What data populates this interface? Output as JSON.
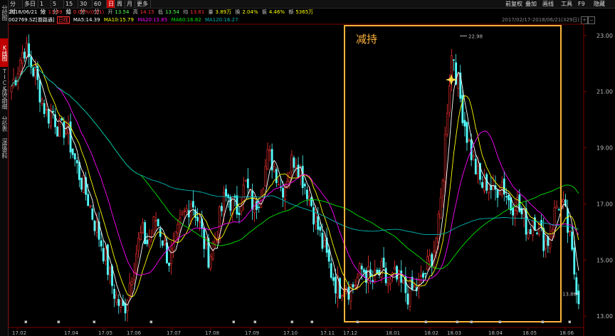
{
  "sidebar": {
    "items": [
      {
        "label": "分时图",
        "active": false
      },
      {
        "label": "K线图",
        "active": true
      },
      {
        "label": "TICK",
        "active": false
      },
      {
        "label": "成交明细",
        "active": false
      },
      {
        "label": "分价表",
        "active": false
      },
      {
        "label": "深度资料",
        "active": false
      }
    ]
  },
  "toolbar": {
    "periods": [
      "分时",
      "多日",
      "1分",
      "5分",
      "15分",
      "30分",
      "60分",
      "日",
      "周",
      "月",
      "更多"
    ],
    "active_period": "日",
    "right_buttons": [
      "前复权",
      "叠加",
      "画线",
      "工具",
      "F9",
      "隐藏"
    ]
  },
  "quote": {
    "date": "2018/06/21",
    "open_label": "收",
    "open_value": "13.69",
    "change_label": "幅",
    "change_value": "0.07%(0.01)",
    "kai_label": "开",
    "kai_value": "13.54",
    "high_label": "高",
    "high_value": "14.15",
    "low_label": "低",
    "low_value": "13.54",
    "avg_label": "均",
    "avg_value": "13.81",
    "vol_label": "量",
    "vol_value": "3.89万",
    "turnover_label": "换",
    "turnover_value": "2.04%",
    "amp_label": "振",
    "amp_value": "4.46%",
    "amount_label": "额",
    "amount_value": "5365万"
  },
  "ma": {
    "code": "002769.SZ",
    "name": "[普路通]",
    "mode": "日线",
    "ma5": "MA5:14.39",
    "ma10": "MA10:15.79",
    "ma20": "MA20:15.85",
    "ma60": "MA60:16.82",
    "ma120": "MA120:16.27"
  },
  "range_text": "2017/02/17-2018/06/21(329日)",
  "annotation": "减持",
  "colors": {
    "up": "#ff3232",
    "down": "#54ffff",
    "ma5": "#ffffff",
    "ma10": "#ffff00",
    "ma20": "#ff00ff",
    "ma60": "#00e600",
    "ma120": "#00b4b4",
    "box": "#ffb43c"
  },
  "chart_data": {
    "type": "candlestick",
    "ylim": [
      12.6,
      23.4
    ],
    "y_ticks": [
      "23.00",
      "21.00",
      "19.00",
      "17.00",
      "15.00",
      "13.00"
    ],
    "x_ticks": [
      "17.02",
      "17.04",
      "17.05",
      "17.06",
      "17.07",
      "17.08",
      "17.09",
      "17.10",
      "17.11",
      "17.12",
      "18.01",
      "18.02",
      "18.03",
      "18.04",
      "18.05",
      "18.06"
    ],
    "high_mark": "22.98",
    "low_mark": "13.80",
    "close_path": [
      21.2,
      21.6,
      22.2,
      22.6,
      22.1,
      21.7,
      21.2,
      20.6,
      20.1,
      20.4,
      19.9,
      19.5,
      19.8,
      19.2,
      18.6,
      18.1,
      17.6,
      17.2,
      16.6,
      16.1,
      15.6,
      15.0,
      14.3,
      13.8,
      13.4,
      13.2,
      14.0,
      14.8,
      15.5,
      16.0,
      15.6,
      15.8,
      16.5,
      16.1,
      15.5,
      15.0,
      15.3,
      15.9,
      16.5,
      16.8,
      17.2,
      16.7,
      16.1,
      15.5,
      15.1,
      15.7,
      16.3,
      17.0,
      17.3,
      17.0,
      16.8,
      17.2,
      17.7,
      17.2,
      16.9,
      17.3,
      18.0,
      18.7,
      18.5,
      18.1,
      17.5,
      17.9,
      18.4,
      18.7,
      18.3,
      17.8,
      17.4,
      16.8,
      16.2,
      15.6,
      15.1,
      14.6,
      14.2,
      14.0,
      14.3,
      14.0,
      14.1,
      14.4,
      14.7,
      14.5,
      14.2,
      14.3,
      14.6,
      14.3,
      14.1,
      14.4,
      14.2,
      14.0,
      13.8,
      13.9,
      14.0,
      14.2,
      14.6,
      15.0,
      15.5,
      16.3,
      18.5,
      21.0,
      22.6,
      21.4,
      20.5,
      19.6,
      18.9,
      18.3,
      17.8,
      17.6,
      17.9,
      17.3,
      17.6,
      17.8,
      17.3,
      16.9,
      17.2,
      16.7,
      16.4,
      16.0,
      16.6,
      16.2,
      15.8,
      15.6,
      16.2,
      16.9,
      17.1,
      16.6,
      15.7,
      14.6,
      13.7
    ]
  }
}
